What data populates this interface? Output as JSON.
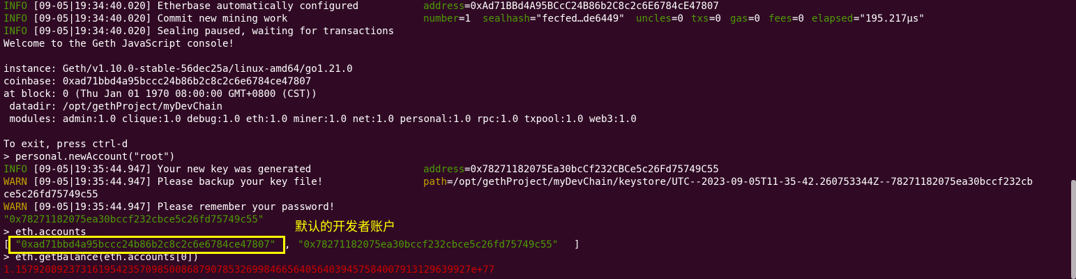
{
  "terminal": {
    "background": "#300a24",
    "colors": {
      "info": "#4e9a06",
      "warn": "#c4a000",
      "error": "#cc0000",
      "annotation": "#ffff00"
    },
    "lines": {
      "l01": {
        "level": "INFO",
        "msg": " [09-05|19:34:40.020] Etherbase automatically configured       ",
        "k1": "address",
        "v1": "=0xAd71BBd4A95BCcC24B86b2C8c2c6E6784cE47807"
      },
      "l02": {
        "level": "INFO",
        "msg": " [09-05|19:34:40.020] Commit new mining work                   ",
        "k1": "number",
        "v1": "=1 ",
        "k2": "sealhash",
        "v2": "=\"fecfed…de6449\" ",
        "k3": "uncles",
        "v3": "=0 ",
        "k4": "txs",
        "v4": "=0 ",
        "k5": "gas",
        "v5": "=0 ",
        "k6": "fees",
        "v6": "=0 ",
        "k7": "elapsed",
        "v7": "=\"195.217µs\""
      },
      "l03": {
        "level": "INFO",
        "msg": " [09-05|19:34:40.020] Sealing paused, waiting for transactions"
      },
      "l04": {
        "text": "Welcome to the Geth JavaScript console!"
      },
      "l06": {
        "text": "instance: Geth/v1.10.0-stable-56dec25a/linux-amd64/go1.21.0"
      },
      "l07": {
        "text": "coinbase: 0xad71bbd4a95bccc24b86b2c8c2c6e6784ce47807"
      },
      "l08": {
        "text": "at block: 0 (Thu Jan 01 1970 08:00:00 GMT+0800 (CST))"
      },
      "l09": {
        "text": " datadir: /opt/gethProject/myDevChain"
      },
      "l10": {
        "text": " modules: admin:1.0 clique:1.0 debug:1.0 eth:1.0 miner:1.0 net:1.0 personal:1.0 rpc:1.0 txpool:1.0 web3:1.0"
      },
      "l12": {
        "text": "To exit, press ctrl-d"
      },
      "l13": {
        "text": "> personal.newAccount(\"root\")"
      },
      "l14": {
        "level": "INFO",
        "msg": " [09-05|19:35:44.947] Your new key was generated               ",
        "k1": "address",
        "v1": "=0x78271182075Ea30bcCf232CBCe5c26Fd75749C55"
      },
      "l15": {
        "level": "WARN",
        "msg": " [09-05|19:35:44.947] Please backup your key file!              ",
        "k1": "path",
        "v1": "=/opt/gethProject/myDevChain/keystore/UTC--2023-09-05T11-35-42.260753344Z--78271182075ea30bccf232cb"
      },
      "l16": {
        "text": "ce5c26fd75749c55"
      },
      "l17": {
        "level": "WARN",
        "msg": " [09-05|19:35:44.947] Please remember your password!"
      },
      "l18": {
        "text": "\"0x78271182075ea30bccf232cbce5c26fd75749c55\""
      },
      "l19": {
        "text": "> eth.accounts"
      },
      "l20": {
        "open": "[",
        "acc1": "\"0xad71bbd4a95bccc24b86b2c8c2c6e6784ce47807\"",
        "sep": ", ",
        "acc2": "\"0x78271182075ea30bccf232cbce5c26fd75749c55\"",
        "close": "]"
      },
      "l21": {
        "text": "> eth.getBalance(eth.accounts[0])"
      },
      "l22": {
        "text": "1.15792089237316195423570985008687907853269984665640564039457584007913129639927e+77"
      }
    },
    "annotation": {
      "label": "默认的开发者账户"
    }
  }
}
